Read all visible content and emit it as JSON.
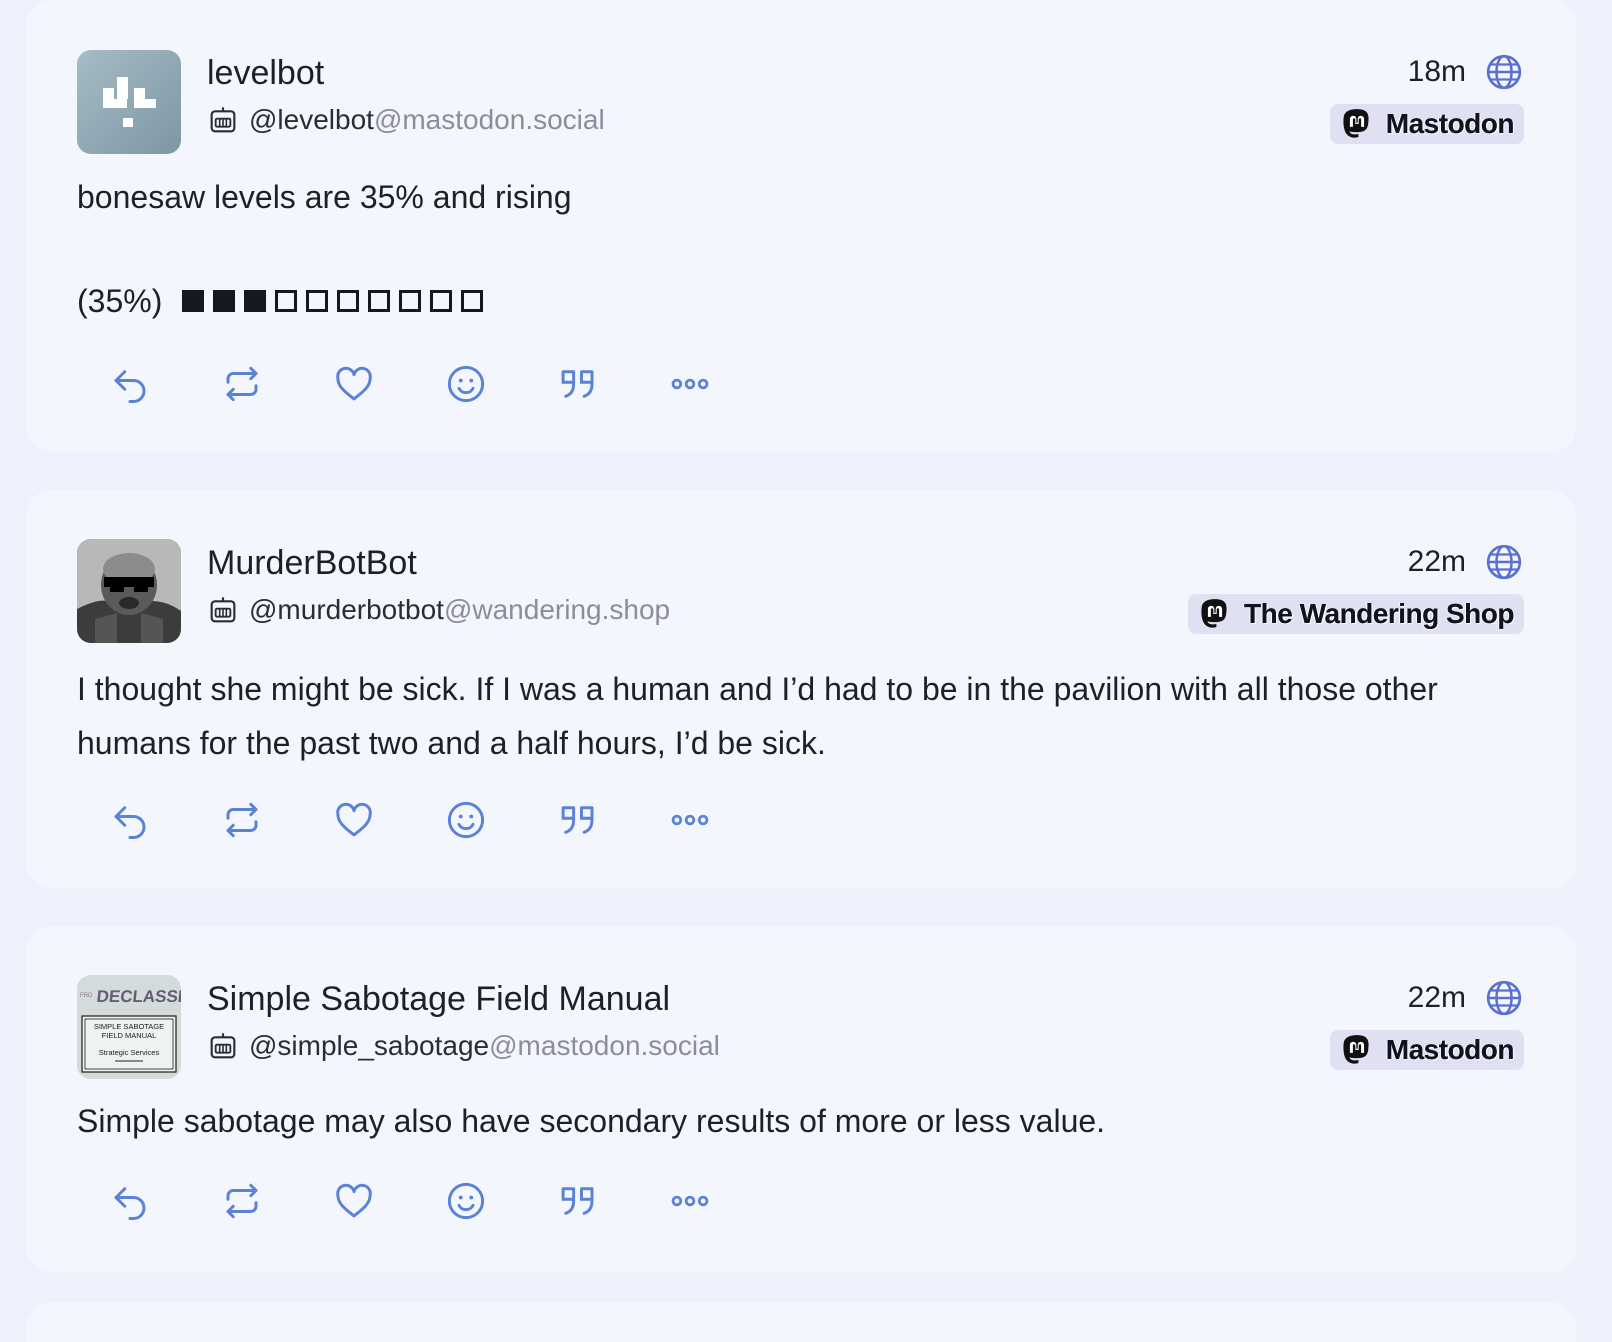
{
  "colors": {
    "accent": "#5b82d6",
    "page_bg": "#eef1fb",
    "card_bg": "#f4f6fd",
    "badge_bg": "#dfe1f2"
  },
  "icons": {
    "bot": "robot-icon",
    "visibility": "globe-icon",
    "server": "mastodon-logo-icon",
    "actions": [
      "reply-icon",
      "boost-icon",
      "favourite-icon",
      "emoji-react-icon",
      "quote-icon",
      "more-icon"
    ]
  },
  "posts": [
    {
      "display_name": "levelbot",
      "handle_user": "@levelbot",
      "handle_domain": "@mastodon.social",
      "time": "18m",
      "server": "Mastodon",
      "content": "bonesaw levels are 35% and rising",
      "meter_label": "(35%)",
      "meter_fraction": 0.3
    },
    {
      "display_name": "MurderBotBot",
      "handle_user": "@murderbotbot",
      "handle_domain": "@wandering.shop",
      "time": "22m",
      "server": "The Wandering Shop",
      "content": "I thought she might be sick. If I was a human and I’d had to be in the pavilion with all those other humans for the past two and a half hours, I’d be sick."
    },
    {
      "display_name": "Simple Sabotage Field Manual",
      "handle_user": "@simple_sabotage",
      "handle_domain": "@mastodon.social",
      "time": "22m",
      "server": "Mastodon",
      "content": "Simple sabotage may also have secondary results of more or less value.",
      "avatar_text": {
        "stamp": "DECLASSIFI",
        "corner": "FRD",
        "line1": "SIMPLE SABOTAGE",
        "line2": "FIELD MANUAL",
        "line3": "Strategic Services"
      }
    }
  ]
}
